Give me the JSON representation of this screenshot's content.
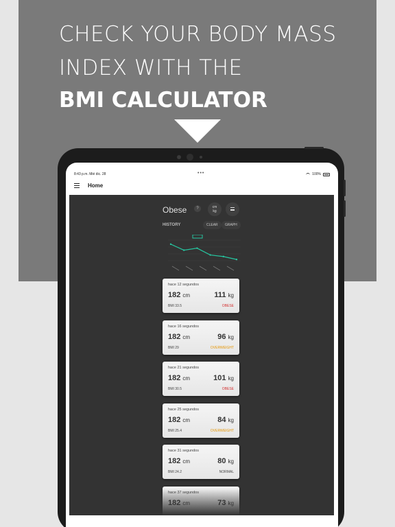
{
  "promo": {
    "line1": "CHECK YOUR BODY MASS",
    "line2": "INDEX WITH THE",
    "line3": "BMI CALCULATOR"
  },
  "status_bar": {
    "time": "8:43 p.m.  Mié dic. 28",
    "dots": "•••",
    "battery": "100%"
  },
  "appbar": {
    "title": "Home"
  },
  "summary": {
    "status": "Obese",
    "help": "?",
    "unit_toggle": {
      "top": "cm",
      "bottom": "kg"
    }
  },
  "history": {
    "label": "HISTORY",
    "clear": "CLEAR",
    "graph": "GRAPH"
  },
  "chart_data": {
    "type": "line",
    "values": [
      33.5,
      29,
      30.5,
      25.4,
      24.2,
      22
    ],
    "color": "#26c6a0"
  },
  "entries": [
    {
      "ago": "hace 12 segundos",
      "height": "182",
      "height_unit": "cm",
      "weight": "111",
      "weight_unit": "kg",
      "bmi": "BMI 33.5",
      "category": "OBESE",
      "category_color": "#d32f2f"
    },
    {
      "ago": "hace 16 segundos",
      "height": "182",
      "height_unit": "cm",
      "weight": "96",
      "weight_unit": "kg",
      "bmi": "BMI 29",
      "category": "OVERWEIGHT",
      "category_color": "#e69500"
    },
    {
      "ago": "hace 21 segundos",
      "height": "182",
      "height_unit": "cm",
      "weight": "101",
      "weight_unit": "kg",
      "bmi": "BMI 30.5",
      "category": "OBESE",
      "category_color": "#d32f2f"
    },
    {
      "ago": "hace 25 segundos",
      "height": "182",
      "height_unit": "cm",
      "weight": "84",
      "weight_unit": "kg",
      "bmi": "BMI 25.4",
      "category": "OVERWEIGHT",
      "category_color": "#e69500"
    },
    {
      "ago": "hace 31 segundos",
      "height": "182",
      "height_unit": "cm",
      "weight": "80",
      "weight_unit": "kg",
      "bmi": "BMI 24.2",
      "category": "NORMAL",
      "category_color": "#444444"
    },
    {
      "ago": "hace 37 segundos",
      "height": "182",
      "height_unit": "cm",
      "weight": "73",
      "weight_unit": "kg",
      "bmi": "",
      "category": "",
      "category_color": "#444444"
    }
  ]
}
